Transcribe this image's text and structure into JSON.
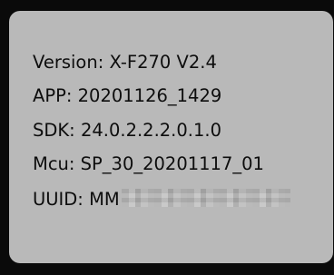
{
  "info_dialog": {
    "version": "Version: X-F270 V2.4",
    "app": "APP: 20201126_1429",
    "sdk": "SDK: 24.0.2.2.2.0.1.0",
    "mcu": "Mcu: SP_30_20201117_01",
    "uuid_label": "UUID: MM",
    "uuid_masked": true
  },
  "colors": {
    "background": "#0a0a0a",
    "panel": "#b9b9b9",
    "text": "#0d0d0d"
  }
}
